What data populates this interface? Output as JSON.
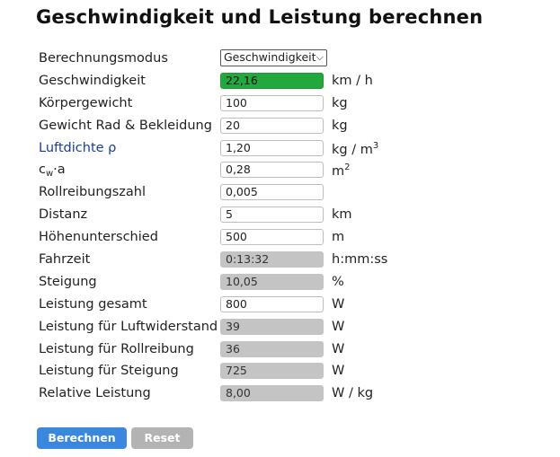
{
  "title": "Geschwindigkeit und Leistung berechnen",
  "rows": [
    {
      "label": "Berechnungsmodus",
      "value": "Geschwindigkeit",
      "unit": ""
    },
    {
      "label": "Geschwindigkeit",
      "value": "22,16",
      "unit": "km / h"
    },
    {
      "label": "Körpergewicht",
      "value": "100",
      "unit": "kg"
    },
    {
      "label": "Gewicht Rad & Bekleidung",
      "value": "20",
      "unit": "kg"
    },
    {
      "label": "Luftdichte ρ",
      "value": "1,20",
      "unit": "kg / m",
      "unit_sup": "3"
    },
    {
      "label": "c",
      "label_sub": "w",
      "label_tail": "·a",
      "value": "0,28",
      "unit": "m",
      "unit_sup": "2"
    },
    {
      "label": "Rollreibungszahl",
      "value": "0,005",
      "unit": ""
    },
    {
      "label": "Distanz",
      "value": "5",
      "unit": "km"
    },
    {
      "label": "Höhenunterschied",
      "value": "500",
      "unit": "m"
    },
    {
      "label": "Fahrzeit",
      "value": "0:13:32",
      "unit": "h:mm:ss"
    },
    {
      "label": "Steigung",
      "value": "10,05",
      "unit": "%"
    },
    {
      "label": "Leistung gesamt",
      "value": "800",
      "unit": "W"
    },
    {
      "label": "Leistung für Luftwiderstand",
      "value": "39",
      "unit": "W"
    },
    {
      "label": "Leistung für Rollreibung",
      "value": "36",
      "unit": "W"
    },
    {
      "label": "Leistung für Steigung",
      "value": "725",
      "unit": "W"
    },
    {
      "label": "Relative Leistung",
      "value": "8,00",
      "unit": "W / kg"
    }
  ],
  "buttons": {
    "calculate": "Berechnen",
    "reset": "Reset"
  },
  "colors": {
    "result_highlight": "#22a83d",
    "readonly": "#c4c4c4",
    "primary_button": "#3a87e0",
    "link_label": "#1a3aa8"
  },
  "icons": {
    "select": "chevron-down-icon"
  }
}
